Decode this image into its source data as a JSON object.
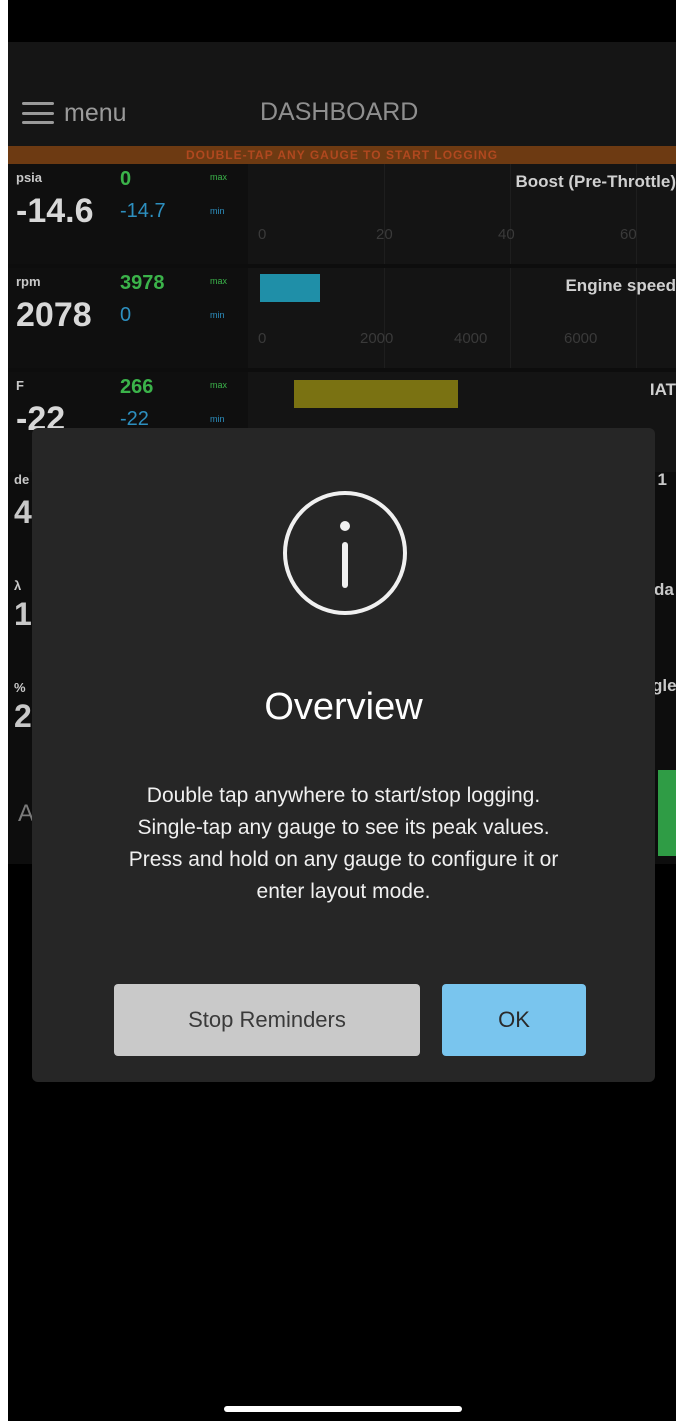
{
  "header": {
    "menu_label": "menu",
    "title": "DASHBOARD",
    "banner": "DOUBLE-TAP ANY GAUGE TO START LOGGING"
  },
  "gauges": [
    {
      "unit": "psia",
      "value": "-14.6",
      "max": "0",
      "min": "-14.7",
      "max_label": "max",
      "min_label": "min",
      "name": "Boost (Pre-Throttle)",
      "ticks": [
        "0",
        "20",
        "40",
        "60"
      ]
    },
    {
      "unit": "rpm",
      "value": "2078",
      "max": "3978",
      "min": "0",
      "max_label": "max",
      "min_label": "min",
      "name": "Engine speed",
      "ticks": [
        "0",
        "2000",
        "4000",
        "6000"
      ],
      "bar_color": "#1f8fa8",
      "bar_level": 0.3
    },
    {
      "unit": "F",
      "value": "-22",
      "max": "266",
      "min": "-22",
      "max_label": "max",
      "min_label": "min",
      "name": "IAT",
      "bar_color": "#7a7212"
    }
  ],
  "partial_rows": [
    {
      "unit": "de",
      "value": "4",
      "name": "l 1"
    },
    {
      "unit": "λ",
      "value": "1",
      "name": "da"
    },
    {
      "unit": "%",
      "value": "2",
      "name": "gle"
    },
    {
      "value": "A"
    }
  ],
  "dialog": {
    "icon": "info-icon",
    "title": "Overview",
    "body_lines": [
      "Double tap anywhere to start/stop logging.",
      "Single-tap any gauge to see its peak values.",
      "Press and hold on any gauge to configure it or",
      "enter layout mode."
    ],
    "stop_button": "Stop Reminders",
    "ok_button": "OK",
    "ok_color": "#79c5ee"
  }
}
